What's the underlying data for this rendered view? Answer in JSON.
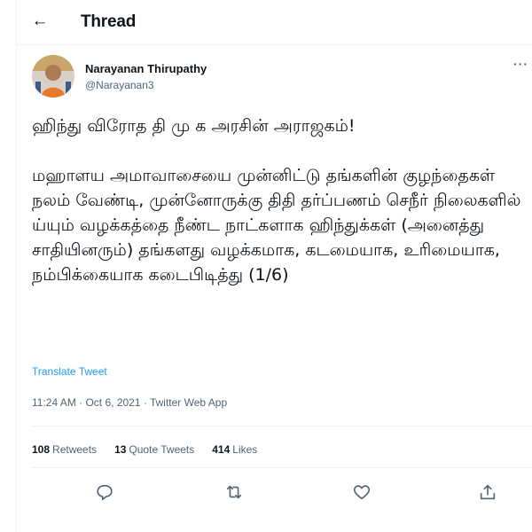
{
  "header": {
    "title": "Thread",
    "back_icon": "arrow-left-icon"
  },
  "author": {
    "name": "Narayanan Thirupathy",
    "handle": "@Narayanan3",
    "more_label": "···"
  },
  "tweet": {
    "headline": "ஹிந்து விரோத தி மு க அரசின் அராஜகம்!",
    "body": "மஹாளய அமாவாசையை முன்னிட்டு தங்களின் குழந்தைகள் நலம் வேண்டி, முன்னோருக்கு திதி தர்ப்பணம் செநீர் நிலைகளில் ய்யும் வழக்கத்தை நீண்ட நாட்களாக ஹிந்துக்கள் (அனைத்து சாதியினரும்) தங்களது வழக்கமாக, கடமையாக, உரிமையாக, நம்பிக்கையாக கடைபிடித்து  (1/6)",
    "translate_label": "Translate Tweet",
    "meta": "11:24 AM · Oct 6, 2021 · Twitter Web App"
  },
  "stats": {
    "retweets": {
      "count": "108",
      "label": "Retweets"
    },
    "quotes": {
      "count": "13",
      "label": "Quote Tweets"
    },
    "likes": {
      "count": "414",
      "label": "Likes"
    }
  },
  "actions": [
    "reply-icon",
    "retweet-icon",
    "like-icon",
    "share-icon"
  ],
  "colors": {
    "accent": "#1d9bf0",
    "text": "#0f1419",
    "muted": "#536471",
    "divider": "#eff3f4"
  }
}
